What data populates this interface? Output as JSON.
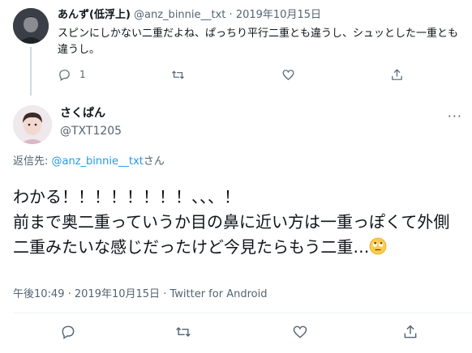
{
  "parent_tweet": {
    "display_name": "あんず(低浮上)",
    "handle": "@anz_binnie__txt",
    "separator": "·",
    "date": "2019年10月15日",
    "text": "スピンにしかない二重だよね、ぱっちり平行二重とも違うし、シュッとした一重とも違うし。",
    "reply_count": "1",
    "icons": [
      "reply-icon",
      "retweet-icon",
      "like-icon",
      "share-icon"
    ]
  },
  "main_tweet": {
    "display_name": "さくぱん",
    "handle": "@TXT1205",
    "more_label": "···",
    "reply_prefix": "返信先: ",
    "reply_handle": "@anz_binnie__txt",
    "reply_suffix": "さん",
    "text_line1": "わかる！！！！！！！！、、、！",
    "text_line2": "前まで奥二重っていうか目の鼻に近い方は一重っぽくて外側二重みたいな感じだったけど今見たらもう二重…",
    "emoji": "face-with-rolling-eyes",
    "time": "午後10:49",
    "date": "2019年10月15日",
    "source": "Twitter for Android",
    "icons": [
      "reply-icon",
      "retweet-icon",
      "like-icon",
      "share-icon"
    ]
  },
  "colors": {
    "text": "#0f1419",
    "secondary": "#536471",
    "link": "#1d9bf0",
    "thread_line": "#cfd9de"
  }
}
